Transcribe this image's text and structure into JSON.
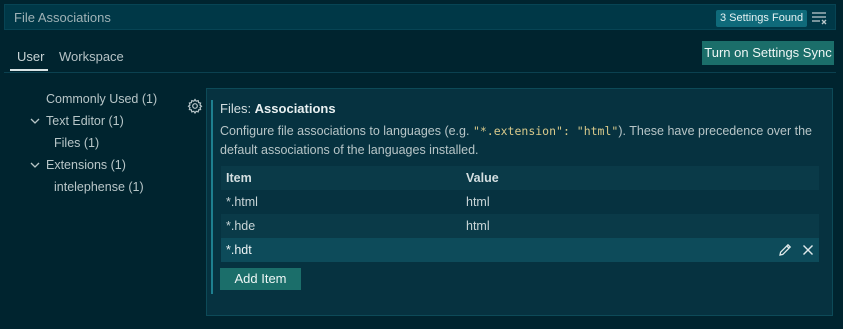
{
  "search": {
    "query": "File Associations",
    "results_badge": "3 Settings Found"
  },
  "tabs": [
    {
      "label": "User",
      "active": true
    },
    {
      "label": "Workspace",
      "active": false
    }
  ],
  "sync_button_label": "Turn on Settings Sync",
  "toc": {
    "items": [
      {
        "label": "Commonly Used (1)",
        "expanded": null
      },
      {
        "label": "Text Editor (1)",
        "expanded": true
      },
      {
        "label": "Files (1)",
        "expanded": null
      },
      {
        "label": "Extensions (1)",
        "expanded": true
      },
      {
        "label": "intelephense (1)",
        "expanded": null
      }
    ]
  },
  "setting": {
    "category": "Files: ",
    "name": "Associations",
    "desc_before": "Configure file associations to languages (e.g. ",
    "desc_code": "\"*.extension\": \"html\"",
    "desc_after": "). These have precedence over the default associations of the languages installed.",
    "table": {
      "headers": [
        "Item",
        "Value"
      ],
      "rows": [
        {
          "item": "*.html",
          "value": "html"
        },
        {
          "item": "*.hde",
          "value": "html"
        },
        {
          "item": "*.hdt",
          "value": ""
        }
      ],
      "selected_row": 2
    },
    "add_button_label": "Add Item"
  },
  "colors": {
    "background": "#00242f",
    "accent_button": "#1b6e6a",
    "badge": "#0f6a7a",
    "code_text": "#d8c98b"
  },
  "icons": {
    "filter": "clear-filter-icon",
    "gear": "gear-icon",
    "edit": "pencil-icon",
    "remove": "close-icon",
    "chevron": "chevron-down-icon"
  }
}
